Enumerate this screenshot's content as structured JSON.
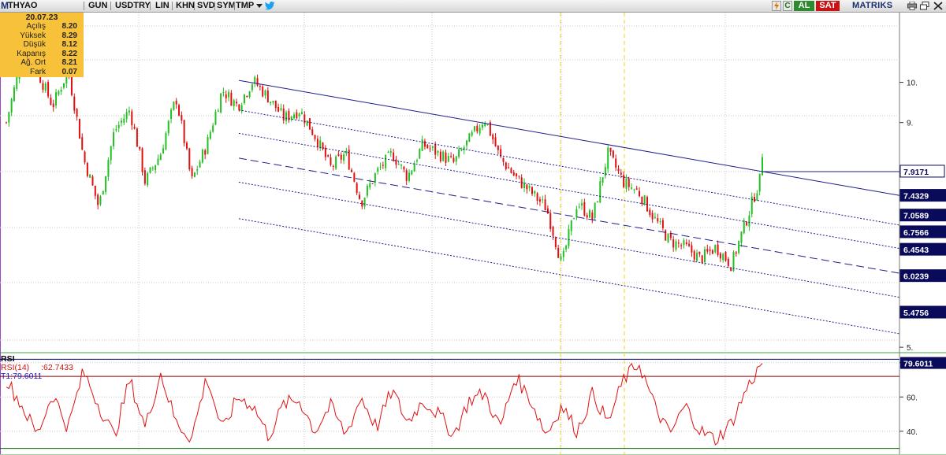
{
  "toolbar": {
    "symbol_prefix": "M",
    "symbol": "THYAO",
    "period": "GUN",
    "currency": "USDTRY",
    "scale": "LIN",
    "khn": "KHN",
    "svd": "SVD",
    "sym": "SYM",
    "tmp": "TMP",
    "buy": "AL",
    "sell": "SAT",
    "brand": "MATRIKS",
    "colors": {
      "buy": "#2e8b2e",
      "sell": "#c81414",
      "brand": "#1a2f6e"
    },
    "icons": [
      "dropdown-arrow-icon",
      "twitter-bird-icon",
      "lightning-icon",
      "c-icon",
      "print-icon",
      "window-restore-icon",
      "close-icon"
    ]
  },
  "info_box": {
    "date": "20.07.23",
    "rows": [
      {
        "label": "Açılış",
        "value": "8.20"
      },
      {
        "label": "Yüksek",
        "value": "8.29"
      },
      {
        "label": "Düşük",
        "value": "8.12"
      },
      {
        "label": "Kapanış",
        "value": "8.22"
      },
      {
        "label": "Ağ. Ort",
        "value": "8.21"
      },
      {
        "label": "Fark",
        "value": "0.07"
      }
    ]
  },
  "chart_data": [
    {
      "type": "candlestick",
      "symbol": "THYAO",
      "price_scale": "log",
      "ylim": [
        4.95,
        12.0
      ],
      "y_ticks": [
        5,
        9,
        10
      ],
      "y_tick_labels": [
        "5.",
        "9.",
        "10."
      ],
      "grid": true,
      "colors": {
        "up": "#22c022",
        "down": "#e01010",
        "channel": "#1e1e8c"
      },
      "price_path": [
        9.0,
        10.6,
        10.3,
        9.4,
        10.3,
        8.2,
        7.2,
        8.8,
        9.3,
        7.7,
        8.3,
        9.6,
        7.7,
        8.5,
        9.8,
        9.4,
        10.05,
        9.6,
        9.1,
        9.3,
        8.7,
        8.0,
        8.3,
        7.3,
        7.9,
        8.3,
        7.8,
        8.5,
        8.3,
        8.1,
        8.6,
        9.1,
        8.2,
        7.8,
        7.5,
        7.2,
        6.2,
        7.3,
        7.0,
        8.3,
        7.7,
        7.5,
        7.0,
        6.6,
        6.5,
        6.3,
        6.5,
        6.2,
        7.0,
        7.9
      ],
      "last_close": 8.22,
      "highlighted_levels": [
        7.9171,
        7.4329,
        7.0589,
        6.7566,
        6.4543,
        6.0239,
        5.4756
      ],
      "vertical_markers": [
        "dashed-yellow",
        "dashed-yellow"
      ],
      "regression_channel": {
        "upper_line": {
          "start": 10.05,
          "end_at_last_bar": 7.9171
        },
        "lower_lines": [
          9.3,
          8.75,
          8.2,
          7.7,
          7.0
        ]
      }
    },
    {
      "type": "line",
      "title": "RSI",
      "legend": [
        {
          "label": "RSI(14)",
          "value": ":62.7433"
        },
        {
          "label": "T1:79.6011"
        }
      ],
      "ylim": [
        28,
        84
      ],
      "y_ticks": [
        40,
        60,
        80
      ],
      "y_tick_labels": [
        "40.",
        "60.",
        "80."
      ],
      "current_value": "79.6011",
      "reference_lines": [
        {
          "value": 82,
          "color": "#000080"
        },
        {
          "value": 72,
          "color": "#8b0000"
        },
        {
          "value": 30,
          "color": "#006400"
        }
      ],
      "rsi_path": [
        70,
        55,
        38,
        62,
        42,
        75,
        55,
        37,
        70,
        42,
        74,
        45,
        36,
        72,
        40,
        60,
        55,
        37,
        56,
        58,
        40,
        55,
        38,
        60,
        42,
        64,
        45,
        58,
        50,
        38,
        58,
        62,
        42,
        72,
        58,
        38,
        55,
        40,
        62,
        45,
        70,
        80,
        55,
        38,
        55,
        40,
        35,
        45,
        65,
        80
      ]
    }
  ]
}
